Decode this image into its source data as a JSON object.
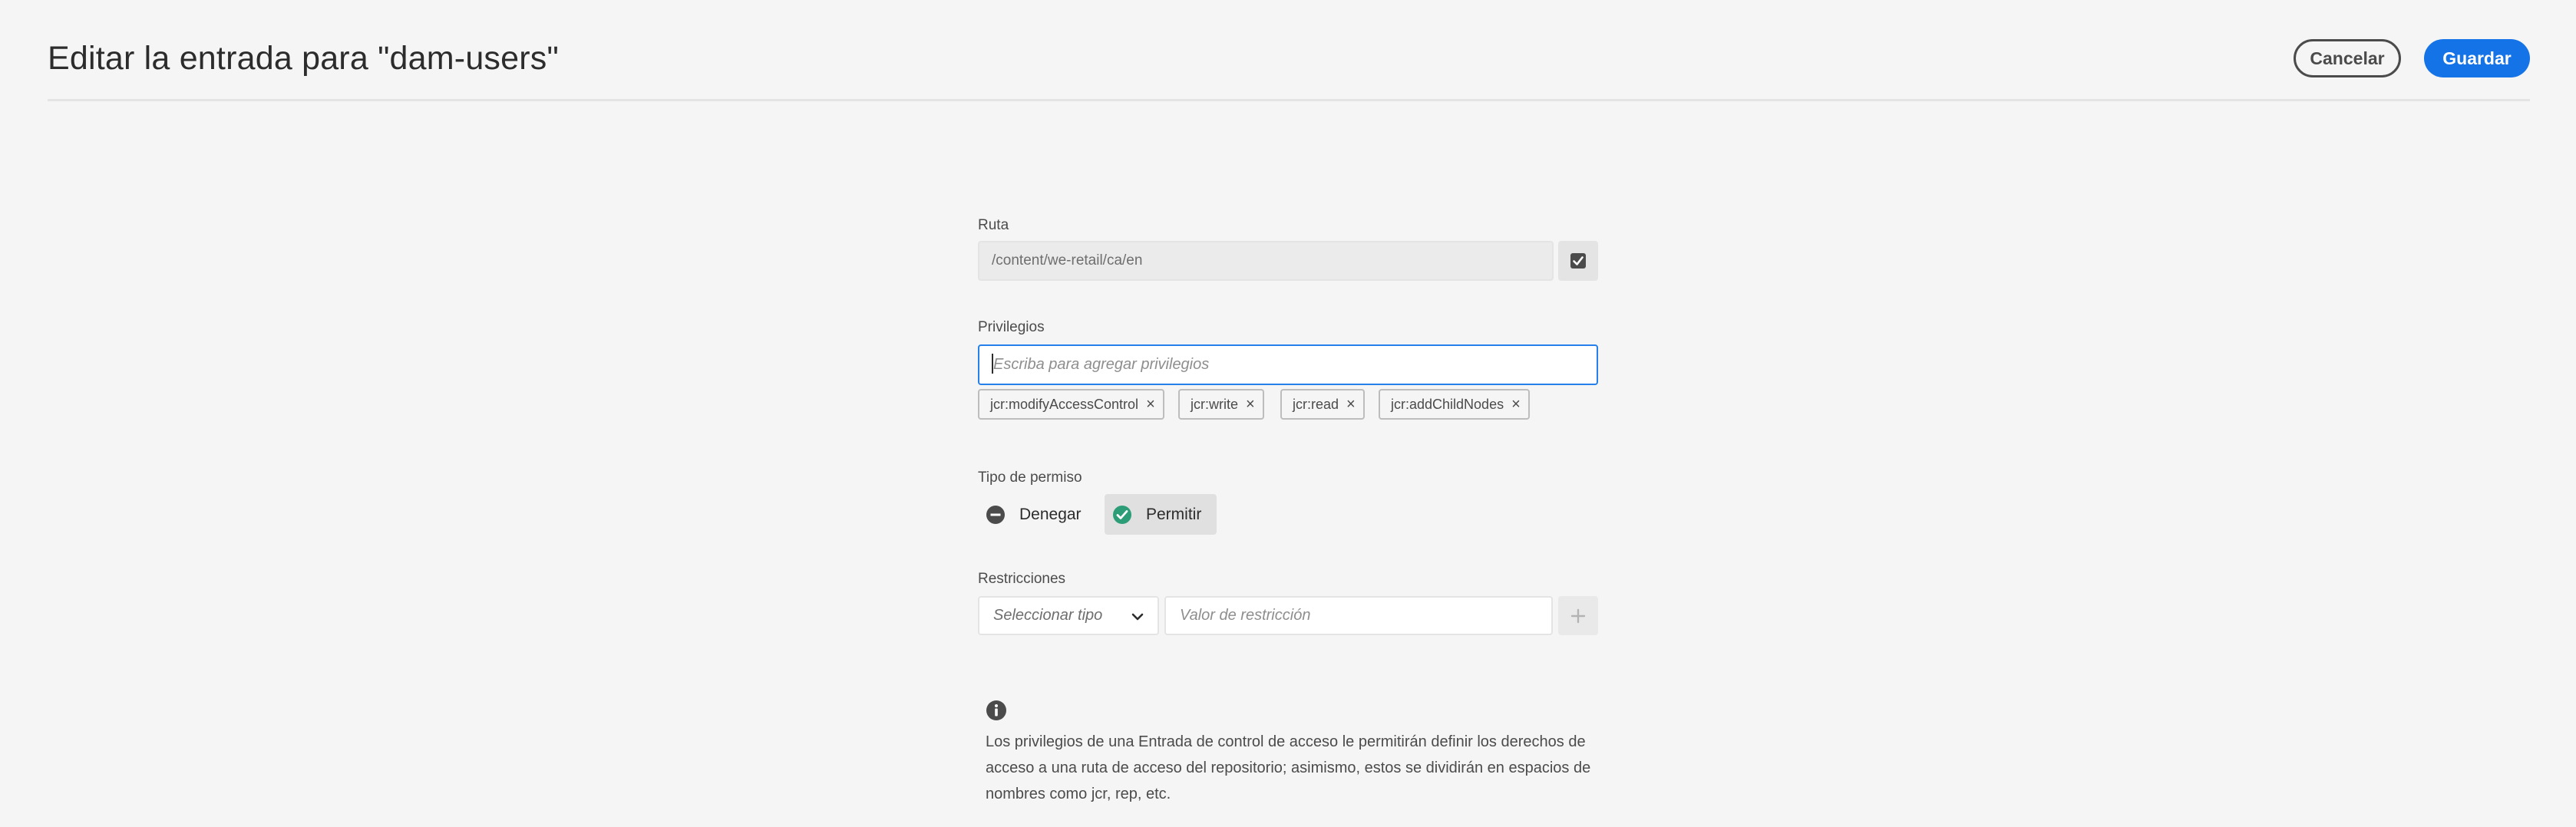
{
  "header": {
    "title": "Editar la entrada para \"dam-users\"",
    "cancel_label": "Cancelar",
    "save_label": "Guardar"
  },
  "path": {
    "label": "Ruta",
    "value": "/content/we-retail/ca/en",
    "checkbox_checked": true
  },
  "privileges": {
    "label": "Privilegios",
    "placeholder": "Escriba para agregar privilegios",
    "tags": [
      "jcr:modifyAccessControl",
      "jcr:write",
      "jcr:read",
      "jcr:addChildNodes"
    ],
    "remove_icon": "close-icon"
  },
  "permission": {
    "label": "Tipo de permiso",
    "deny_label": "Denegar",
    "allow_label": "Permitir",
    "selected": "Permitir",
    "allow_color": "#2d9d78"
  },
  "restrictions": {
    "label": "Restricciones",
    "type_placeholder": "Seleccionar tipo",
    "value_placeholder": "Valor de restricción"
  },
  "info": {
    "icon": "info-icon",
    "text": "Los privilegios de una Entrada de control de acceso le permitirán definir los derechos de acceso a una ruta de acceso del repositorio; asimismo, estos se dividirán en espacios de nombres como jcr, rep, etc."
  },
  "colors": {
    "accent": "#1473e6",
    "focus_border": "#2680eb",
    "background": "#f5f5f5"
  }
}
